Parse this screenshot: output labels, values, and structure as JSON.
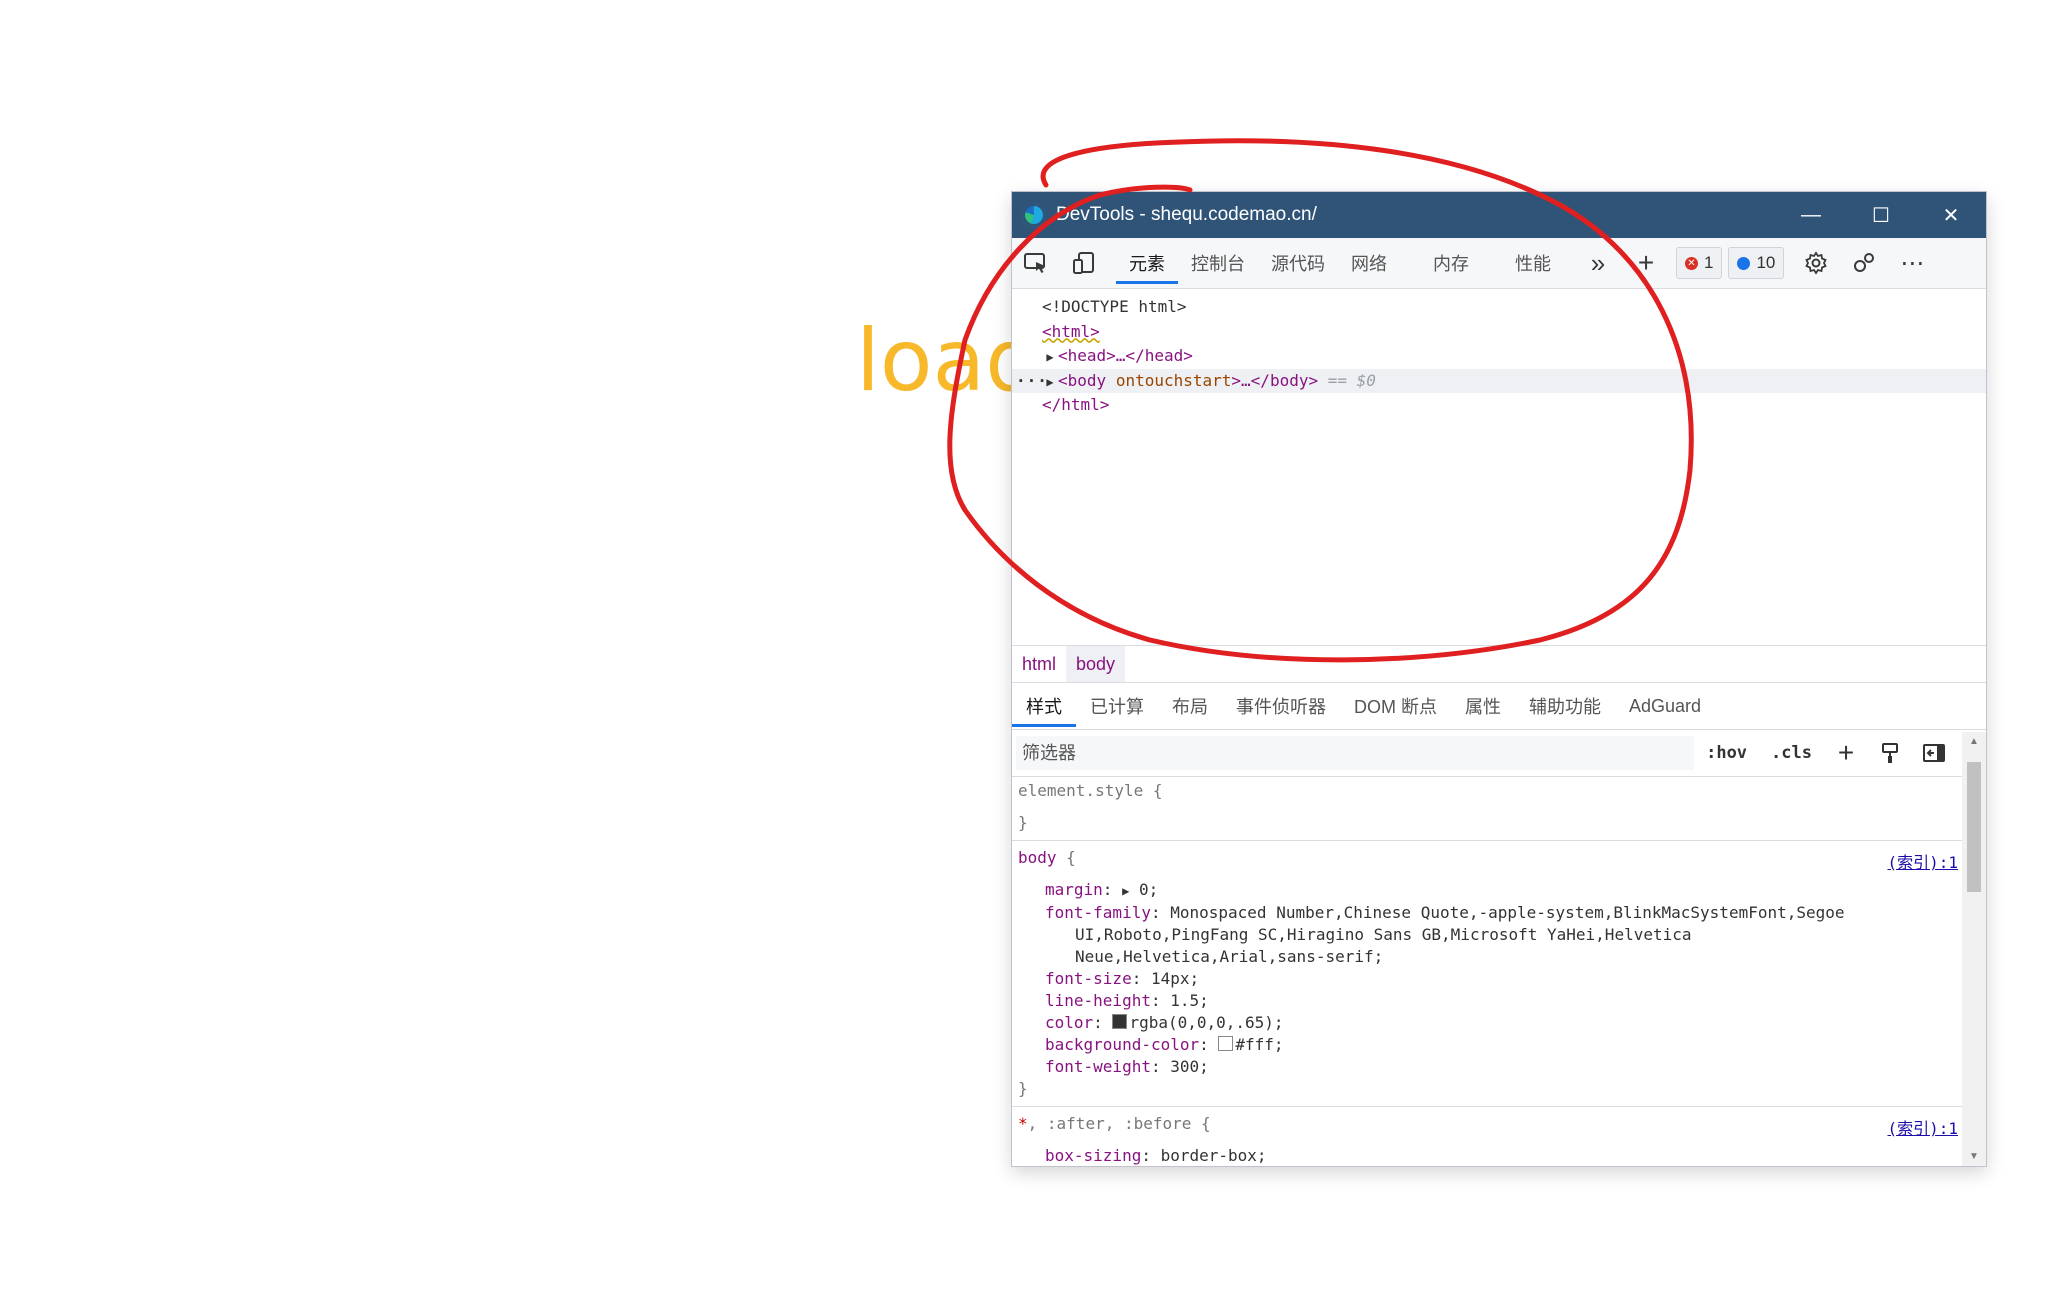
{
  "page": {
    "loading_text": "loadi"
  },
  "devtools": {
    "title": "DevTools - shequ.codemao.cn/",
    "window_controls": {
      "minimize": "—",
      "maximize": "☐",
      "close": "✕"
    },
    "toolbar": {
      "tabs": [
        "元素",
        "控制台",
        "源代码",
        "网络",
        "内存",
        "性能"
      ],
      "more": "»",
      "add": "+",
      "error_count": "1",
      "info_count": "10",
      "overflow": "⋯"
    },
    "dom": {
      "doctype": "<!DOCTYPE html>",
      "html_open": "<html>",
      "head": "<head>…</head>",
      "body_open": "<body",
      "body_attr": "ontouchstart",
      "body_rest": ">…</body>",
      "body_ref": "== $0",
      "html_close": "</html>",
      "dots": "···"
    },
    "breadcrumb": [
      "html",
      "body"
    ],
    "subtabs": [
      "样式",
      "已计算",
      "布局",
      "事件侦听器",
      "DOM 断点",
      "属性",
      "辅助功能",
      "AdGuard"
    ],
    "filter": {
      "placeholder": "筛选器",
      "hov": ":hov",
      "cls": ".cls"
    },
    "styles": {
      "element_style": "element.style {",
      "close": "}",
      "body_selector": "body",
      "open": " {",
      "source": "(索引):1",
      "body_decls": {
        "margin_p": "margin",
        "margin_v": "0;",
        "ff_p": "font-family",
        "ff_v1": "Monospaced Number,Chinese Quote,-apple-system,BlinkMacSystemFont,Segoe",
        "ff_v2": "UI,Roboto,PingFang SC,Hiragino Sans GB,Microsoft YaHei,Helvetica",
        "ff_v3": "Neue,Helvetica,Arial,sans-serif;",
        "fs_p": "font-size",
        "fs_v": "14px;",
        "lh_p": "line-height",
        "lh_v": "1.5;",
        "color_p": "color",
        "color_v": "rgba(0,0,0,.65);",
        "bg_p": "background-color",
        "bg_v": "#fff;",
        "fw_p": "font-weight",
        "fw_v": "300;"
      },
      "universal_selector": "*",
      "universal_rest": ", :after, :before {",
      "box_p": "box-sizing",
      "box_v": "border-box;"
    }
  },
  "colors": {
    "titlebar": "#2f5478",
    "accent": "#1a73e8",
    "annotation": "#e02020",
    "loading": "#f7b82a"
  }
}
